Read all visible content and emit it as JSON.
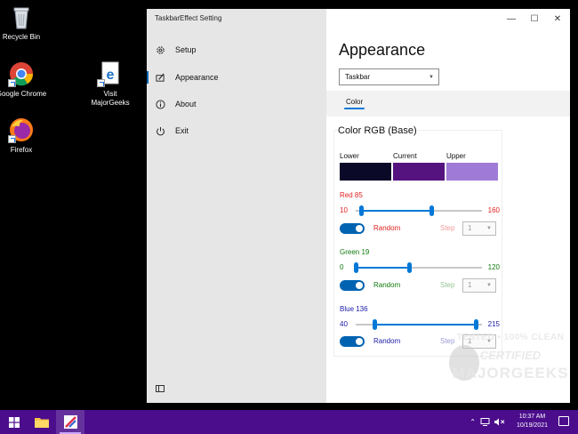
{
  "desktop": {
    "icons": [
      {
        "label": "Recycle Bin"
      },
      {
        "label": "Google Chrome"
      },
      {
        "label": "Visit MajorGeeks"
      },
      {
        "label": "Firefox"
      }
    ]
  },
  "window": {
    "app_title": "TaskbarEffect Setting",
    "nav": [
      {
        "label": "Setup",
        "icon": "gear-icon"
      },
      {
        "label": "Appearance",
        "icon": "paint-icon",
        "selected": true
      },
      {
        "label": "About",
        "icon": "info-icon"
      },
      {
        "label": "Exit",
        "icon": "power-icon"
      }
    ],
    "controls": {
      "minimize": "—",
      "maximize": "☐",
      "close": "✕"
    }
  },
  "appearance": {
    "title": "Appearance",
    "target_select": "Taskbar",
    "tab": "Color",
    "card_title": "Color RGB (Base)",
    "swatches": [
      {
        "label": "Lower",
        "color": "#0a0a28"
      },
      {
        "label": "Current",
        "color": "#55137f"
      },
      {
        "label": "Upper",
        "color": "#a07ad7"
      }
    ],
    "channels": [
      {
        "title": "Red 85",
        "color": "#e02020",
        "min": "10",
        "max": "160",
        "lower": 0.04,
        "upper": 0.6,
        "random_label": "Random",
        "step_label": "Step",
        "step_value": "1"
      },
      {
        "title": "Green 19",
        "color": "#107c10",
        "min": "0",
        "max": "120",
        "lower": 0.0,
        "upper": 0.42,
        "random_label": "Random",
        "step_label": "Step",
        "step_value": "1"
      },
      {
        "title": "Blue 136",
        "color": "#1a1aa8",
        "min": "40",
        "max": "215",
        "lower": 0.15,
        "upper": 0.95,
        "random_label": "Random",
        "step_label": "Step",
        "step_value": "1"
      }
    ]
  },
  "watermark": {
    "line1": "TESTED • 100% CLEAN",
    "line2": "CERTIFIED",
    "line3": "MAJORGEEKS"
  },
  "taskbar": {
    "time": "10:37 AM",
    "date": "10/19/2021",
    "tray_icons": [
      "chevron-up-icon",
      "network-icon",
      "volume-mute-icon"
    ]
  }
}
